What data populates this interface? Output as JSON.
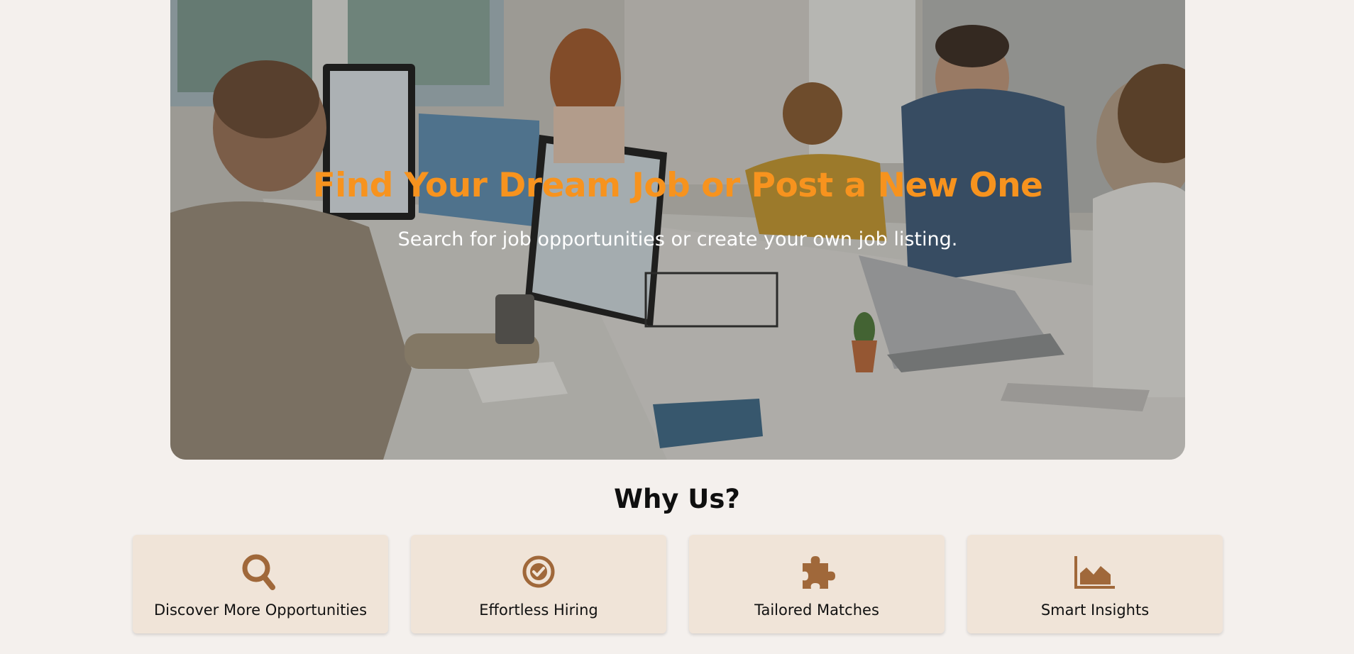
{
  "hero": {
    "title": "Find Your Dream Job or Post a New One",
    "subtitle": "Search for job opportunities or create your own job listing.",
    "title_color": "#f7931e"
  },
  "why_us": {
    "heading": "Why Us?",
    "features": [
      {
        "icon": "search-icon",
        "label": "Discover More Opportunities"
      },
      {
        "icon": "check-circle-icon",
        "label": "Effortless Hiring"
      },
      {
        "icon": "puzzle-piece-icon",
        "label": "Tailored Matches"
      },
      {
        "icon": "area-chart-icon",
        "label": "Smart Insights"
      }
    ],
    "icon_color": "#a0683a",
    "card_color": "#f0e4d8"
  }
}
